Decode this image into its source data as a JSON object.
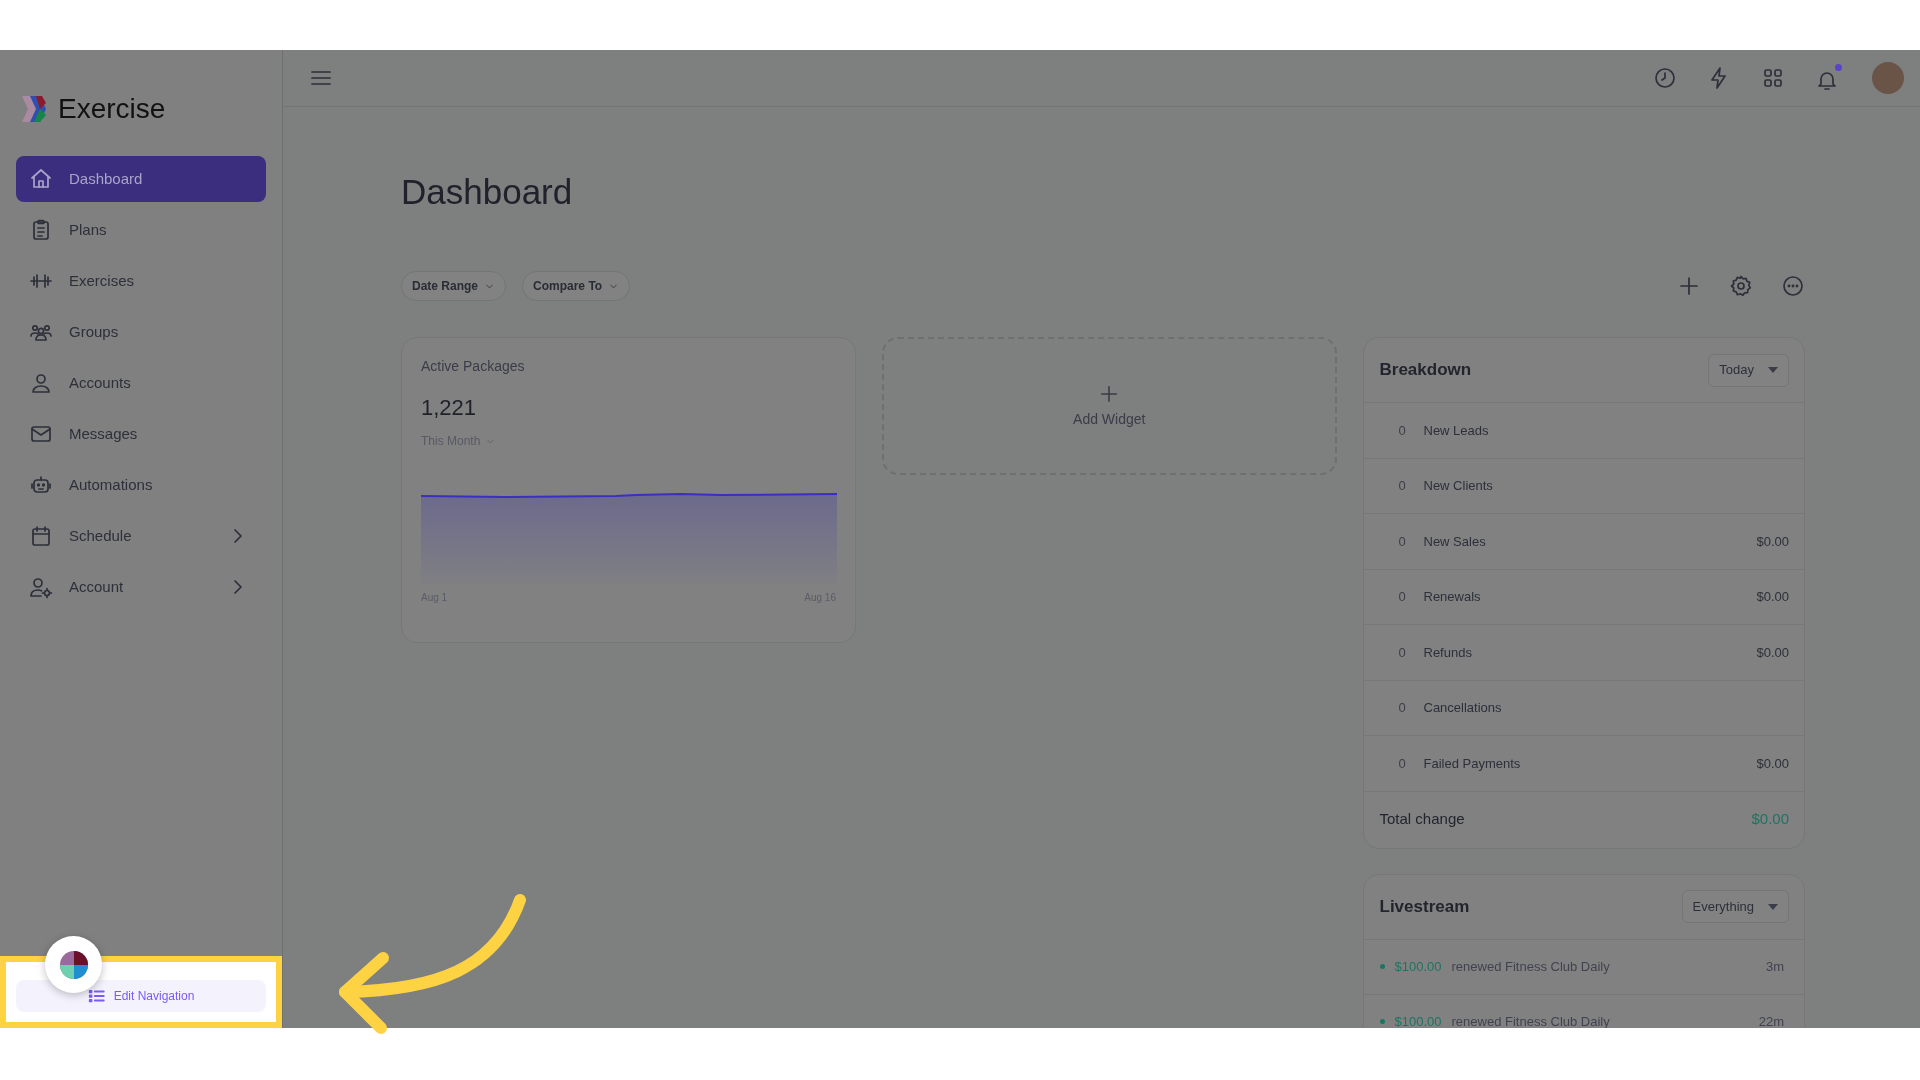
{
  "sidebar": {
    "logo_text": "Exercise",
    "items": [
      {
        "label": "Dashboard",
        "selected": true,
        "has_submenu": false
      },
      {
        "label": "Plans",
        "selected": false,
        "has_submenu": false
      },
      {
        "label": "Exercises",
        "selected": false,
        "has_submenu": false
      },
      {
        "label": "Groups",
        "selected": false,
        "has_submenu": false
      },
      {
        "label": "Accounts",
        "selected": false,
        "has_submenu": false
      },
      {
        "label": "Messages",
        "selected": false,
        "has_submenu": false
      },
      {
        "label": "Automations",
        "selected": false,
        "has_submenu": false
      },
      {
        "label": "Schedule",
        "selected": false,
        "has_submenu": true
      },
      {
        "label": "Account",
        "selected": false,
        "has_submenu": true
      }
    ],
    "edit_navigation": "Edit Navigation"
  },
  "topbar": {
    "notifications_unread": true
  },
  "page": {
    "title": "Dashboard",
    "filters": [
      "Date Range",
      "Compare To"
    ]
  },
  "active_packages": {
    "title": "Active Packages",
    "value": "1,221",
    "period": "This Month",
    "x_start": "Aug 1",
    "x_end": "Aug 16"
  },
  "add_widget": {
    "label": "Add Widget"
  },
  "breakdown": {
    "title": "Breakdown",
    "period": "Today",
    "rows": [
      {
        "count": "0",
        "label": "New Leads"
      },
      {
        "count": "0",
        "label": "New Clients"
      },
      {
        "count": "0",
        "label": "New Sales",
        "amount": "$0.00"
      },
      {
        "count": "0",
        "label": "Renewals",
        "amount": "$0.00"
      },
      {
        "count": "0",
        "label": "Refunds",
        "amount": "$0.00"
      },
      {
        "count": "0",
        "label": "Cancellations"
      },
      {
        "count": "0",
        "label": "Failed Payments",
        "amount": "$0.00"
      }
    ],
    "total_label": "Total change",
    "total_value": "$0.00"
  },
  "livestream": {
    "title": "Livestream",
    "filter": "Everything",
    "events": [
      {
        "amount": "$100.00",
        "text": "renewed Fitness Club Daily",
        "time": "3m"
      },
      {
        "amount": "$100.00",
        "text": "renewed Fitness Club Daily",
        "time": "22m"
      }
    ]
  }
}
